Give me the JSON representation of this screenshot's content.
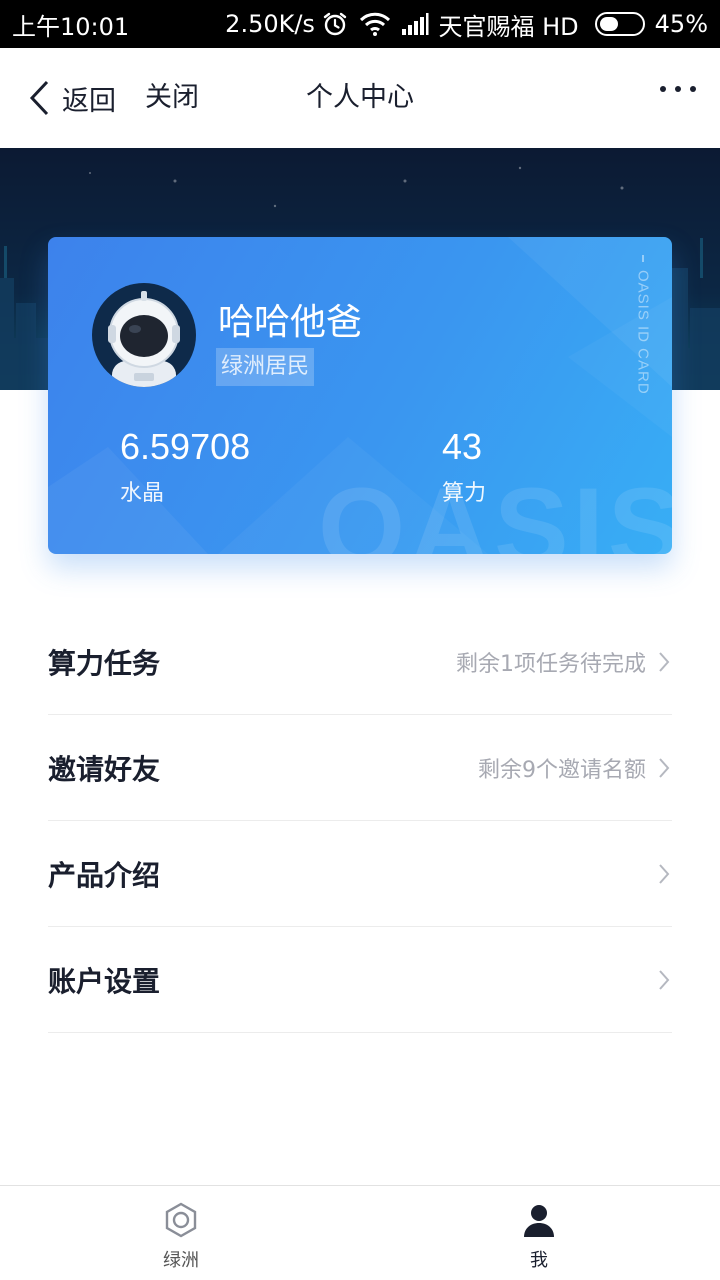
{
  "status_bar": {
    "time": "上午10:01",
    "speed": "2.50K/s",
    "carrier": "天官赐福 HD",
    "battery": "45%",
    "battery_level": 0.45
  },
  "nav": {
    "back_label": "返回",
    "close_label": "关闭",
    "title": "个人中心"
  },
  "card": {
    "username": "哈哈他爸",
    "badge": "绿洲居民",
    "vertical_text": "OASIS ID CARD",
    "watermark": "OASIS",
    "stats": [
      {
        "value": "6.59708",
        "label": "水晶"
      },
      {
        "value": "43",
        "label": "算力"
      }
    ]
  },
  "menu": [
    {
      "label": "算力任务",
      "hint": "剩余1项任务待完成"
    },
    {
      "label": "邀请好友",
      "hint": "剩余9个邀请名额"
    },
    {
      "label": "产品介绍",
      "hint": ""
    },
    {
      "label": "账户设置",
      "hint": ""
    }
  ],
  "tabs": [
    {
      "label": "绿洲",
      "icon": "oasis-ring-icon",
      "active": false
    },
    {
      "label": "我",
      "icon": "person-icon",
      "active": true
    }
  ],
  "colors": {
    "card_gradient_start": "#3d82ec",
    "card_gradient_end": "#38aef5",
    "hero_bg": "#0c1a33",
    "text_primary": "#1a1f2e",
    "text_hint": "#a7a9b2"
  }
}
